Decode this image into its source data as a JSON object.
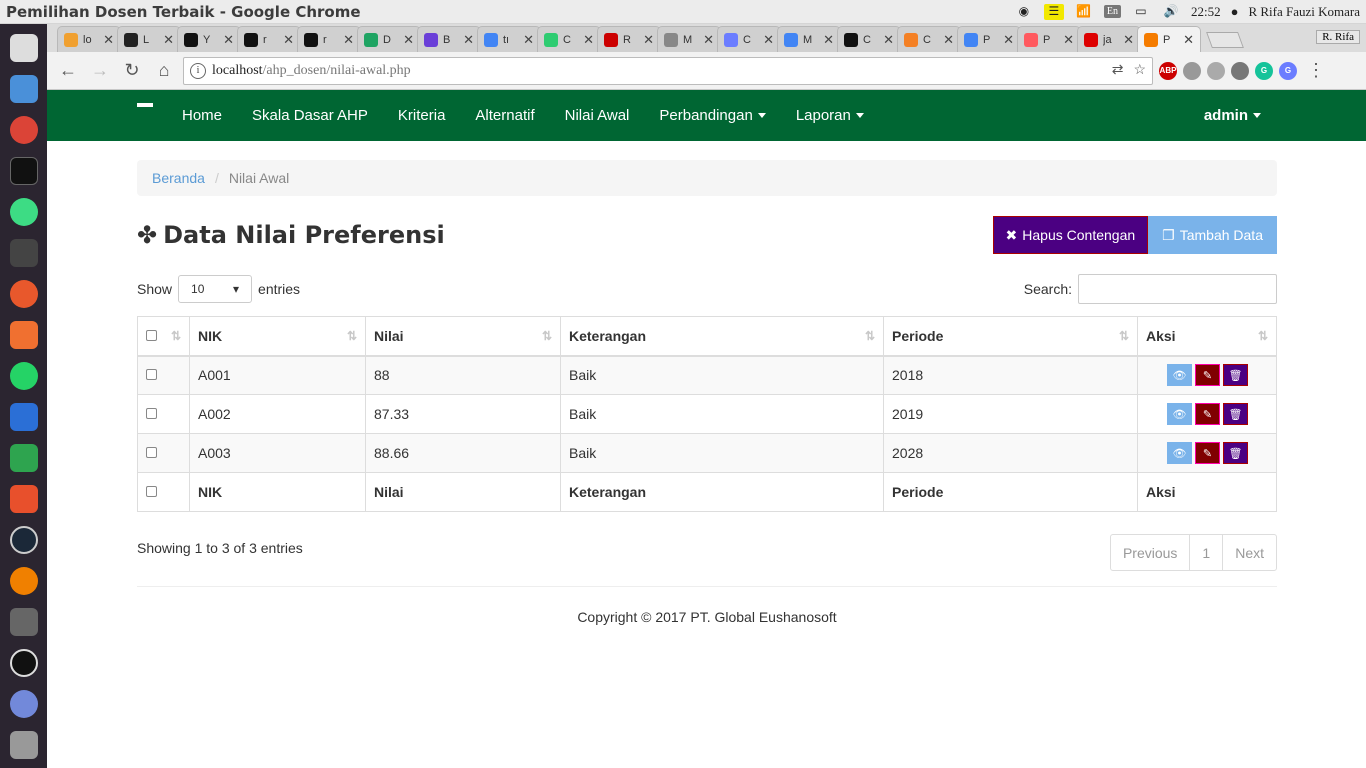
{
  "os": {
    "window_title": "Pemilihan Dosen Terbaik - Google Chrome",
    "lang": "En",
    "time": "22:52",
    "user": "R Rifa Fauzi Komara"
  },
  "browser": {
    "tabs": [
      {
        "fav": "#f0a030",
        "label": "lo"
      },
      {
        "fav": "#222",
        "label": "L"
      },
      {
        "fav": "#111",
        "label": "Y"
      },
      {
        "fav": "#111",
        "label": "r"
      },
      {
        "fav": "#111",
        "label": "r"
      },
      {
        "fav": "#1fa463",
        "label": "D"
      },
      {
        "fav": "#6a3fd8",
        "label": "B"
      },
      {
        "fav": "#4285f4",
        "label": "tı"
      },
      {
        "fav": "#2ecc71",
        "label": "C"
      },
      {
        "fav": "#c00",
        "label": "R"
      },
      {
        "fav": "#888",
        "label": "M"
      },
      {
        "fav": "#6b7dff",
        "label": "C"
      },
      {
        "fav": "#4285f4",
        "label": "M"
      },
      {
        "fav": "#111",
        "label": "C"
      },
      {
        "fav": "#f48024",
        "label": "C"
      },
      {
        "fav": "#4285f4",
        "label": "P"
      },
      {
        "fav": "#ff5a5f",
        "label": "P"
      },
      {
        "fav": "#d00",
        "label": "ja"
      },
      {
        "fav": "#f57c00",
        "label": "P",
        "active": true
      }
    ],
    "profile": "R. Rifa",
    "url_host": "localhost",
    "url_path": "/ahp_dosen/nilai-awal.php"
  },
  "navbar": {
    "items": [
      "Home",
      "Skala Dasar AHP",
      "Kriteria",
      "Alternatif",
      "Nilai Awal",
      "Perbandingan",
      "Laporan"
    ],
    "user": "admin"
  },
  "breadcrumb": {
    "home": "Beranda",
    "current": "Nilai Awal"
  },
  "page": {
    "title": "Data Nilai Preferensi",
    "btn_delete": "Hapus Contengan",
    "btn_add": "Tambah Data"
  },
  "table_controls": {
    "show": "Show",
    "entries_value": "10",
    "entries": "entries",
    "search": "Search:"
  },
  "table": {
    "headers": [
      "NIK",
      "Nilai",
      "Keterangan",
      "Periode",
      "Aksi"
    ],
    "rows": [
      [
        "A001",
        "88",
        "Baik",
        "2018"
      ],
      [
        "A002",
        "87.33",
        "Baik",
        "2019"
      ],
      [
        "A003",
        "88.66",
        "Baik",
        "2028"
      ]
    ]
  },
  "pagination": {
    "info": "Showing 1 to 3 of 3 entries",
    "previous": "Previous",
    "page": "1",
    "next": "Next"
  },
  "footer": "Copyright © 2017 PT. Global Eushanosoft"
}
